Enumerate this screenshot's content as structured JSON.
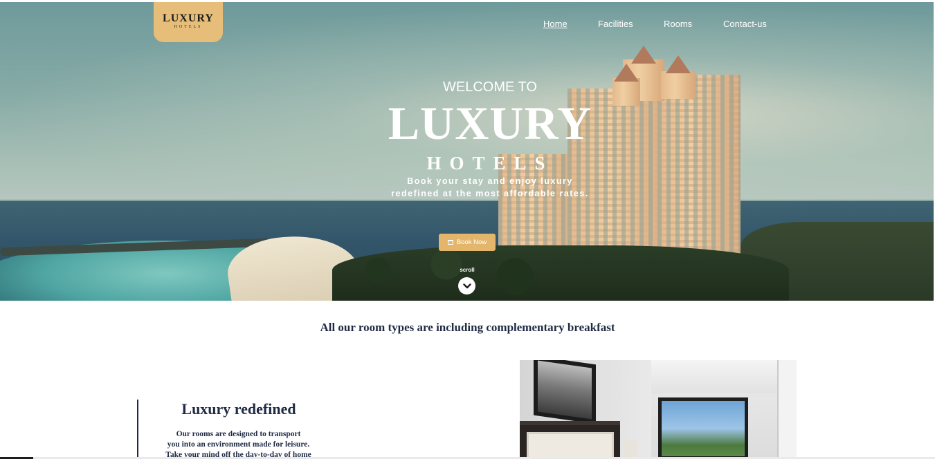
{
  "logo": {
    "main": "LUXURY",
    "sub": "HOTELS"
  },
  "nav": {
    "items": [
      {
        "label": "Home",
        "active": true
      },
      {
        "label": "Facilities",
        "active": false
      },
      {
        "label": "Rooms",
        "active": false
      },
      {
        "label": "Contact-us",
        "active": false
      }
    ]
  },
  "hero": {
    "welcome": "WELCOME TO",
    "title": "LUXURY",
    "subtitle": "HOTELS",
    "tagline_line1": "Book your stay and enjoy luxury",
    "tagline_line2": "redefined at the most affordable rates.",
    "book_button": "Book Now",
    "book_icon": "calendar-icon",
    "scroll_label": "scroll",
    "scroll_icon": "chevron-down-icon"
  },
  "breakfast_notice": "All our room types are including complementary breakfast",
  "feature": {
    "title": "Luxury redefined",
    "body_line1": "Our rooms are designed to transport",
    "body_line2": "you into an environment made for leisure.",
    "body_line3": "Take your mind off the day-to-day of home"
  },
  "colors": {
    "gold": "#e6bd79",
    "button": "#e3b66c",
    "navy": "#1f2a44",
    "white": "#ffffff"
  }
}
